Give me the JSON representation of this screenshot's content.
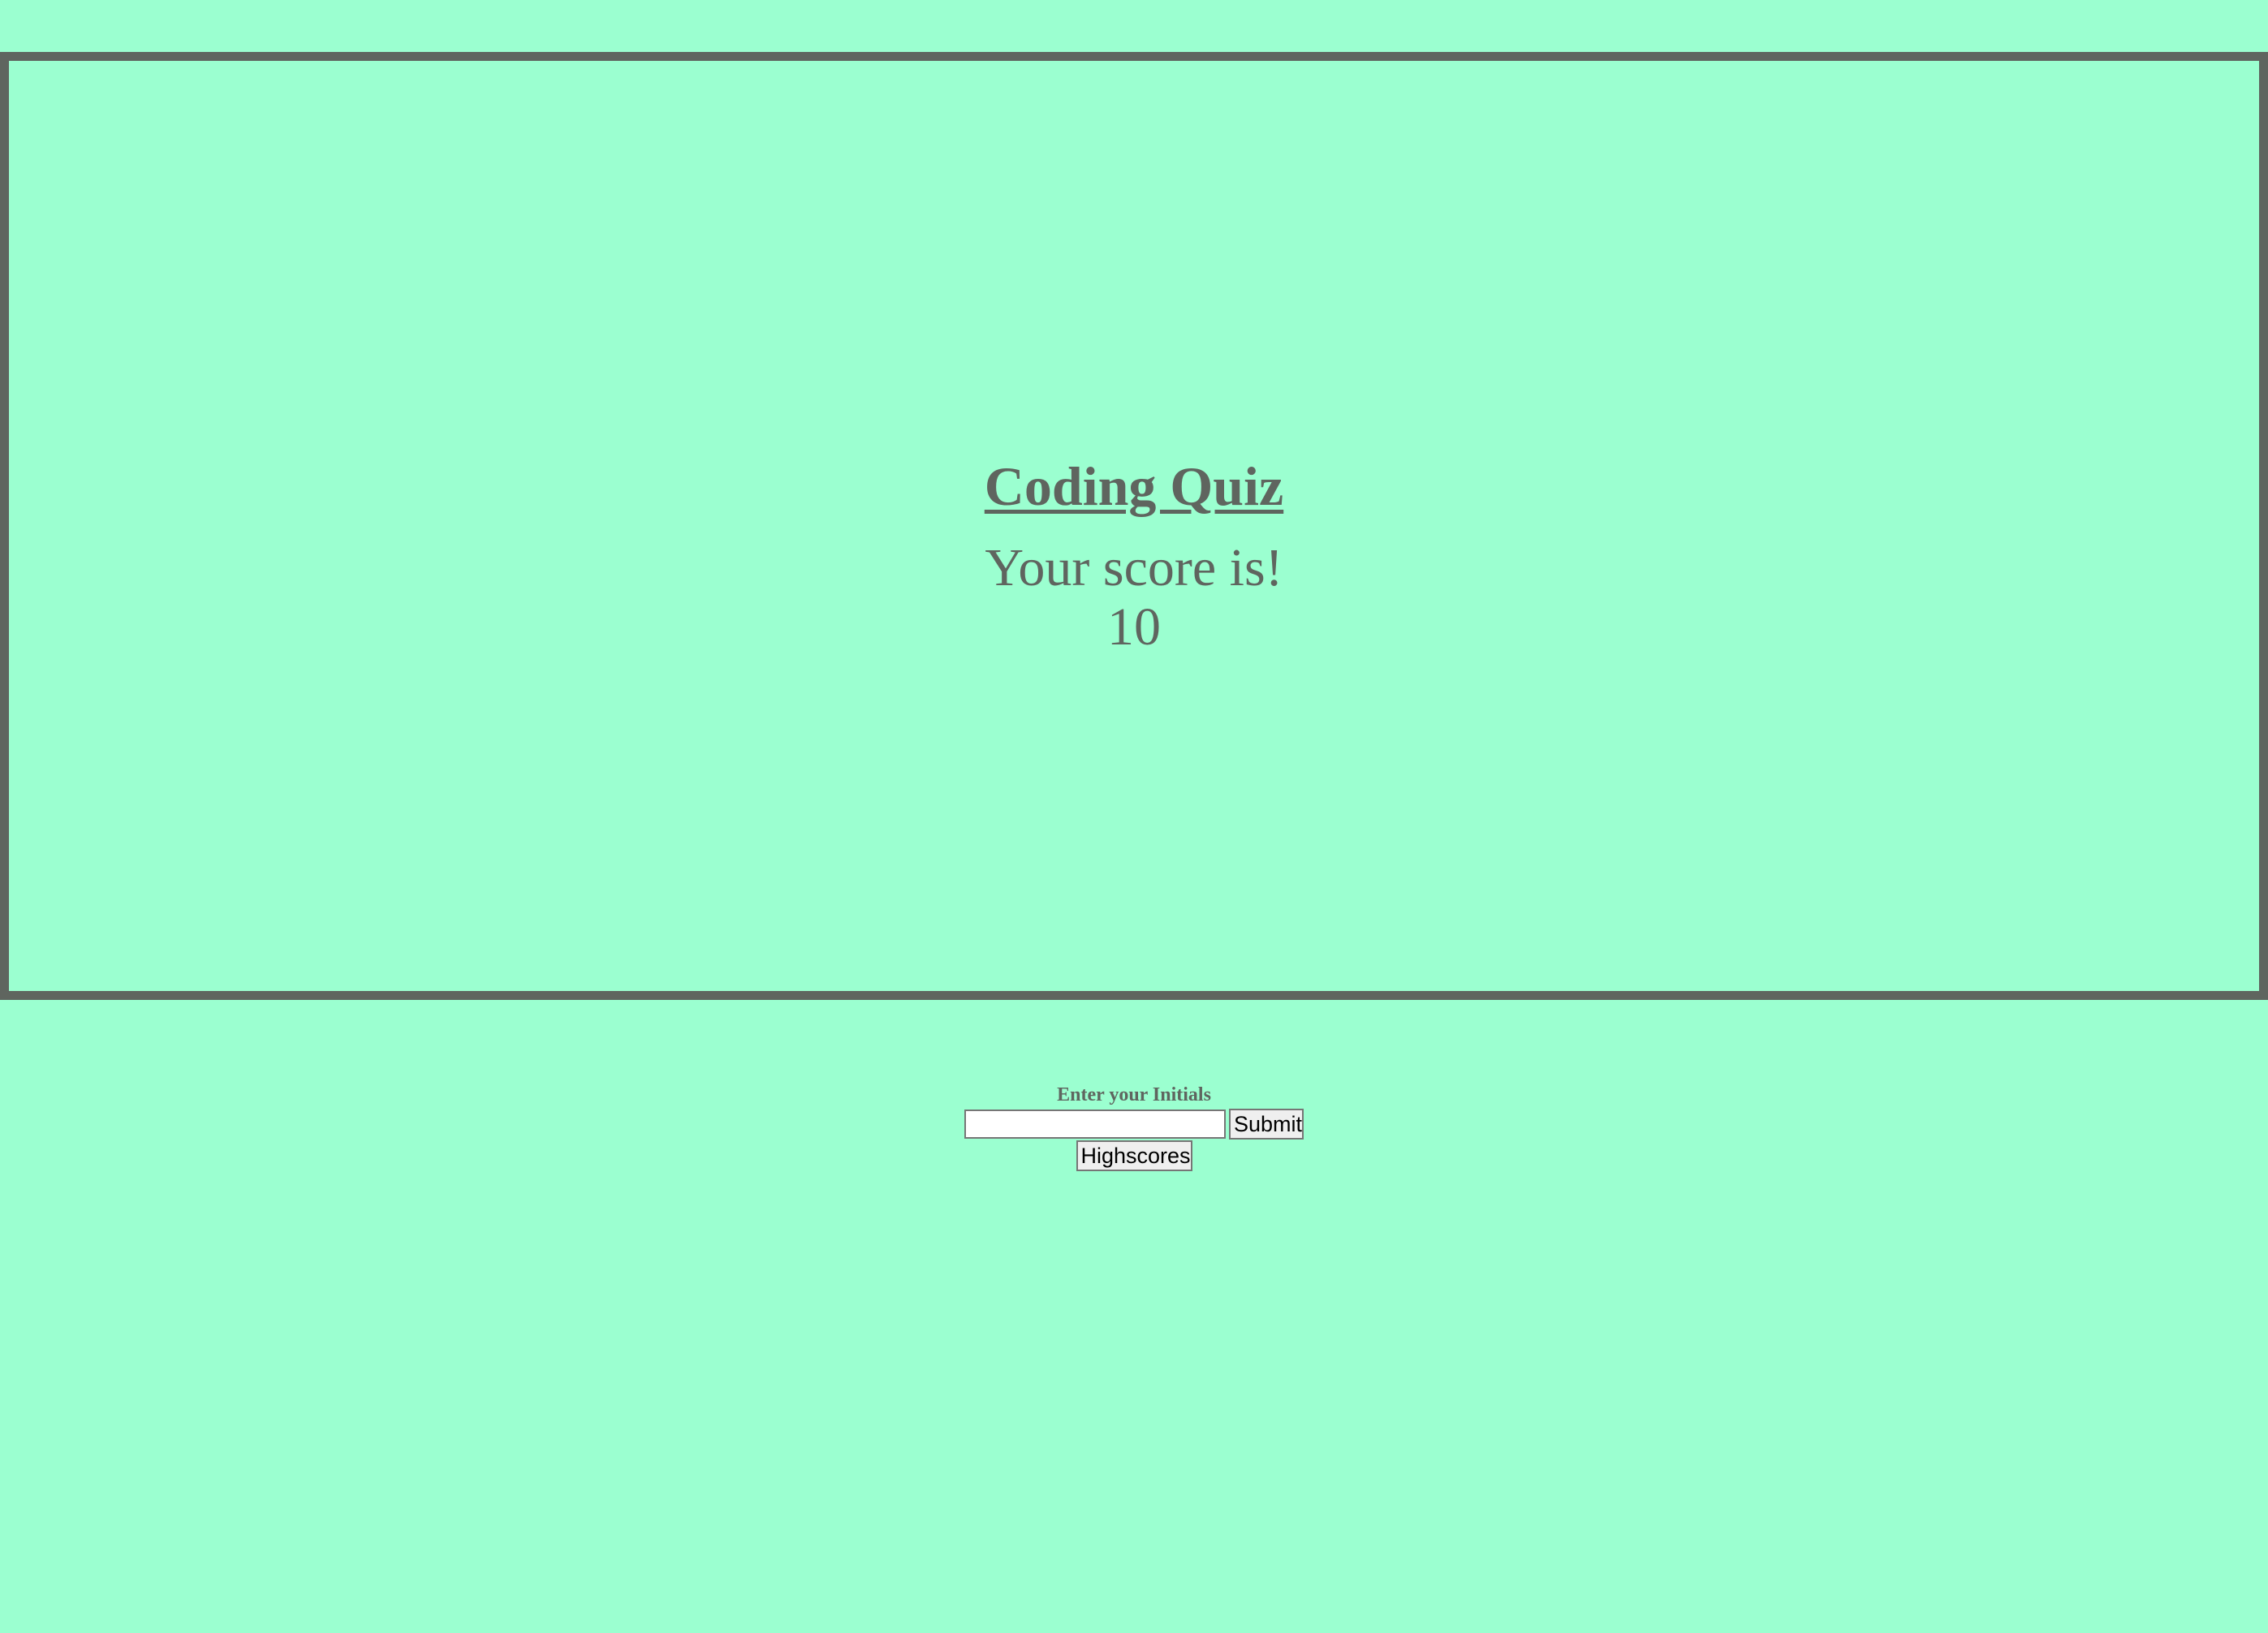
{
  "quiz": {
    "title": "Coding Quiz",
    "score_label": "Your score is!",
    "score_value": "10"
  },
  "form": {
    "initials_label": "Enter your Initials",
    "initials_value": "",
    "submit_label": "Submit",
    "highscores_label": "Highscores"
  },
  "colors": {
    "background": "#9bffd0",
    "text": "#5f655f",
    "border": "#5f655f"
  }
}
